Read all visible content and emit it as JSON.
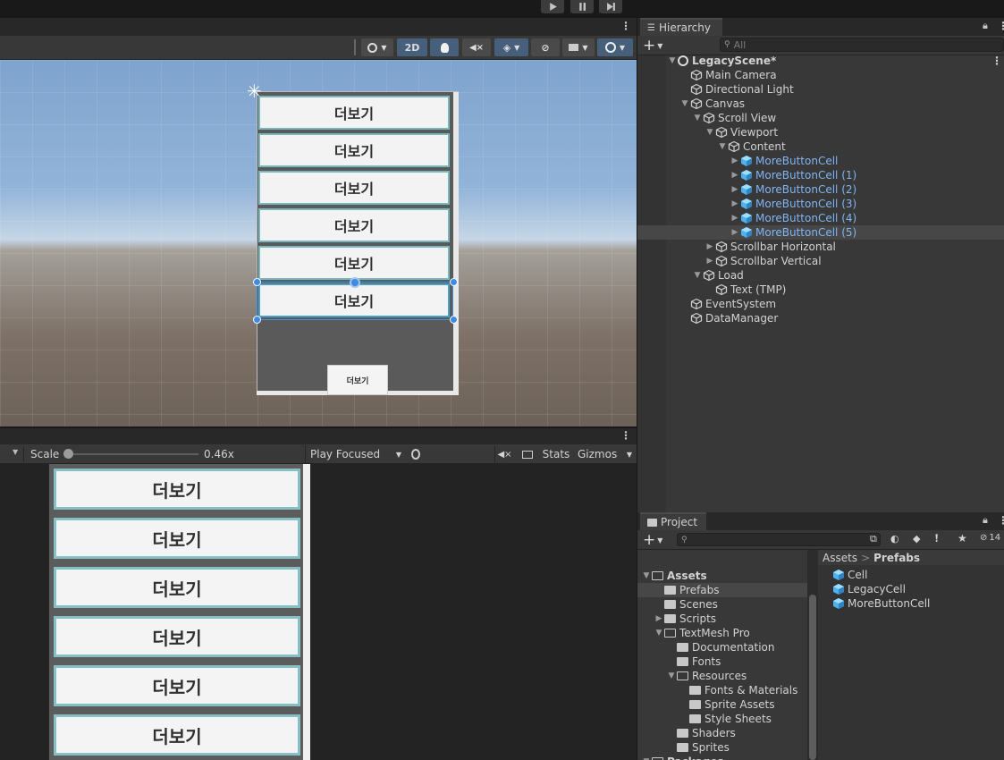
{
  "toolbar": {
    "play_icon": "play-icon",
    "pause_icon": "pause-icon",
    "step_icon": "step-icon"
  },
  "scene": {
    "mode_2d": "2D",
    "cells": [
      "더보기",
      "더보기",
      "더보기",
      "더보기",
      "더보기",
      "더보기"
    ],
    "bottom_button": "더보기"
  },
  "game": {
    "scale_label": "Scale",
    "scale_value": "0.46x",
    "play_mode": "Play Focused",
    "stats": "Stats",
    "gizmos": "Gizmos",
    "cells": [
      "더보기",
      "더보기",
      "더보기",
      "더보기",
      "더보기",
      "더보기"
    ]
  },
  "hierarchy": {
    "title": "Hierarchy",
    "search_placeholder": "All",
    "scene_name": "LegacyScene*",
    "items": [
      {
        "label": "Main Camera",
        "depth": 1,
        "arrow": "",
        "prefab": false
      },
      {
        "label": "Directional Light",
        "depth": 1,
        "arrow": "",
        "prefab": false
      },
      {
        "label": "Canvas",
        "depth": 1,
        "arrow": "▼",
        "prefab": false
      },
      {
        "label": "Scroll View",
        "depth": 2,
        "arrow": "▼",
        "prefab": false
      },
      {
        "label": "Viewport",
        "depth": 3,
        "arrow": "▼",
        "prefab": false
      },
      {
        "label": "Content",
        "depth": 4,
        "arrow": "▼",
        "prefab": false
      },
      {
        "label": "MoreButtonCell",
        "depth": 5,
        "arrow": "▶",
        "prefab": true
      },
      {
        "label": "MoreButtonCell (1)",
        "depth": 5,
        "arrow": "▶",
        "prefab": true
      },
      {
        "label": "MoreButtonCell (2)",
        "depth": 5,
        "arrow": "▶",
        "prefab": true
      },
      {
        "label": "MoreButtonCell (3)",
        "depth": 5,
        "arrow": "▶",
        "prefab": true
      },
      {
        "label": "MoreButtonCell (4)",
        "depth": 5,
        "arrow": "▶",
        "prefab": true
      },
      {
        "label": "MoreButtonCell (5)",
        "depth": 5,
        "arrow": "▶",
        "prefab": true,
        "selected": true
      },
      {
        "label": "Scrollbar Horizontal",
        "depth": 3,
        "arrow": "▶",
        "prefab": false
      },
      {
        "label": "Scrollbar Vertical",
        "depth": 3,
        "arrow": "▶",
        "prefab": false
      },
      {
        "label": "Load",
        "depth": 2,
        "arrow": "▼",
        "prefab": false
      },
      {
        "label": "Text (TMP)",
        "depth": 3,
        "arrow": "",
        "prefab": false
      },
      {
        "label": "EventSystem",
        "depth": 1,
        "arrow": "",
        "prefab": false
      },
      {
        "label": "DataManager",
        "depth": 1,
        "arrow": "",
        "prefab": false
      }
    ]
  },
  "project": {
    "title": "Project",
    "breadcrumb_root": "Assets",
    "breadcrumb_sep": ">",
    "breadcrumb_current": "Prefabs",
    "tree": [
      {
        "label": "Assets",
        "depth": 0,
        "arrow": "▼",
        "open": true
      },
      {
        "label": "Prefabs",
        "depth": 1,
        "arrow": "",
        "open": false,
        "selected": true
      },
      {
        "label": "Scenes",
        "depth": 1,
        "arrow": "",
        "open": false
      },
      {
        "label": "Scripts",
        "depth": 1,
        "arrow": "▶",
        "open": false
      },
      {
        "label": "TextMesh Pro",
        "depth": 1,
        "arrow": "▼",
        "open": true
      },
      {
        "label": "Documentation",
        "depth": 2,
        "arrow": "",
        "open": false
      },
      {
        "label": "Fonts",
        "depth": 2,
        "arrow": "",
        "open": false
      },
      {
        "label": "Resources",
        "depth": 2,
        "arrow": "▼",
        "open": true
      },
      {
        "label": "Fonts & Materials",
        "depth": 3,
        "arrow": "",
        "open": false
      },
      {
        "label": "Sprite Assets",
        "depth": 3,
        "arrow": "",
        "open": false
      },
      {
        "label": "Style Sheets",
        "depth": 3,
        "arrow": "",
        "open": false
      },
      {
        "label": "Shaders",
        "depth": 2,
        "arrow": "",
        "open": false
      },
      {
        "label": "Sprites",
        "depth": 2,
        "arrow": "",
        "open": false
      },
      {
        "label": "Packages",
        "depth": 0,
        "arrow": "▼",
        "open": true
      }
    ],
    "assets": [
      "Cell",
      "LegacyCell",
      "MoreButtonCell"
    ],
    "hidden_count": "14"
  }
}
